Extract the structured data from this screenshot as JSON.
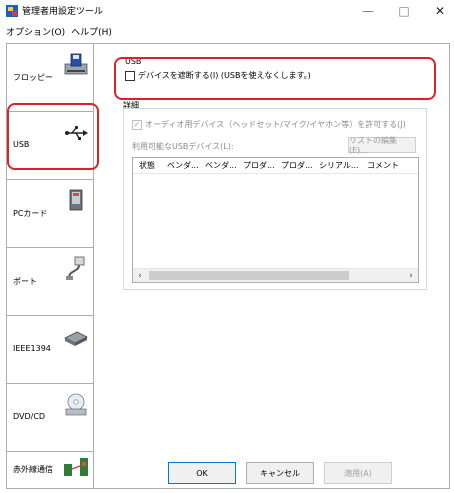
{
  "window": {
    "title": "管理者用設定ツール",
    "min_glyph": "—",
    "max_glyph": "□",
    "close_glyph": "✕"
  },
  "menu": [
    {
      "label": "オプション(O)"
    },
    {
      "label": "ヘルプ(H)"
    }
  ],
  "sidebar": {
    "items": [
      {
        "label": "フロッピー",
        "icon": "floppy-drive-icon"
      },
      {
        "label": "USB",
        "icon": "usb-icon"
      },
      {
        "label": "PCカード",
        "icon": "pc-card-icon"
      },
      {
        "label": "ポート",
        "icon": "port-cable-icon"
      },
      {
        "label": "IEEE1394",
        "icon": "ieee1394-icon"
      },
      {
        "label": "DVD/CD",
        "icon": "dvd-cd-icon"
      },
      {
        "label": "赤外線通信",
        "icon": "infrared-icon"
      }
    ]
  },
  "usb": {
    "group_title": "USB",
    "block_label": "デバイスを遮断する(I) (USBを使えなくします。)",
    "block_checked": false
  },
  "detail": {
    "title": "詳細",
    "audio_label": "オーディオ用デバイス（ヘッドセット/マイク/イヤホン等）を許可する(J)",
    "audio_checked": true,
    "allowed_label": "利用可能なUSBデバイス(L):",
    "list_edit_button": "リストの編集(E)...",
    "columns": [
      "状態",
      "ベンダ...",
      "ベンダ...",
      "プロダ...",
      "プロダ...",
      "シリアル...",
      "コメント"
    ],
    "scroll_left": "‹",
    "scroll_right": "›"
  },
  "footer": {
    "ok": "OK",
    "cancel": "キャンセル",
    "apply": "適用(A)"
  },
  "colors": {
    "highlight": "#d9222a",
    "border": "#adadad",
    "disabled_text": "#8a8a8a"
  }
}
